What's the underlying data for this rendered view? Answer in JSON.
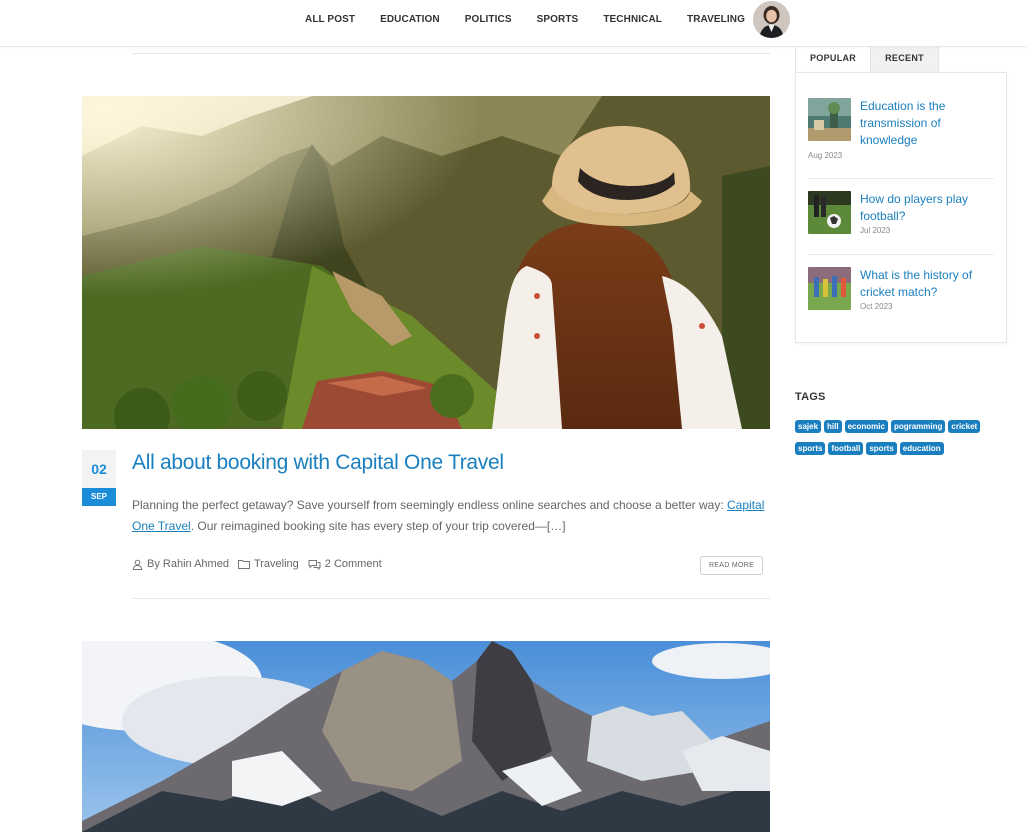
{
  "nav": {
    "items": [
      "ALL POST",
      "EDUCATION",
      "POLITICS",
      "SPORTS",
      "TECHNICAL",
      "TRAVELING"
    ]
  },
  "post1": {
    "day": "02",
    "month": "SEP",
    "title": "All about booking with Capital One Travel",
    "excerpt_start": "Planning the perfect getaway? Save yourself from seemingly endless online searches and choose a better way: ",
    "excerpt_link": "Capital One Travel",
    "excerpt_end": ". Our reimagined booking site has every step of your trip covered—[…]",
    "author": "By Rahin Ahmed",
    "category": "Traveling",
    "comments": "2 Comment",
    "read_more": "READ MORE"
  },
  "sidebar": {
    "tabs": [
      "POPULAR",
      "RECENT"
    ],
    "popular": [
      {
        "title": "Education is the transmission of knowledge",
        "date": "Aug 2023"
      },
      {
        "title": "How do players play football?",
        "date": "Jul 2023"
      },
      {
        "title": "What is the history of cricket match?",
        "date": "Oct 2023"
      }
    ],
    "tags_title": "TAGS",
    "tags": [
      "sajek",
      "hill",
      "economic",
      "pogramming",
      "cricket",
      "sports",
      "football",
      "sports",
      "education"
    ]
  },
  "colors": {
    "accent": "#1a7fbf",
    "date_badge": "#1a8cd8"
  },
  "icons": [
    "user-icon",
    "folder-icon",
    "comment-icon"
  ]
}
